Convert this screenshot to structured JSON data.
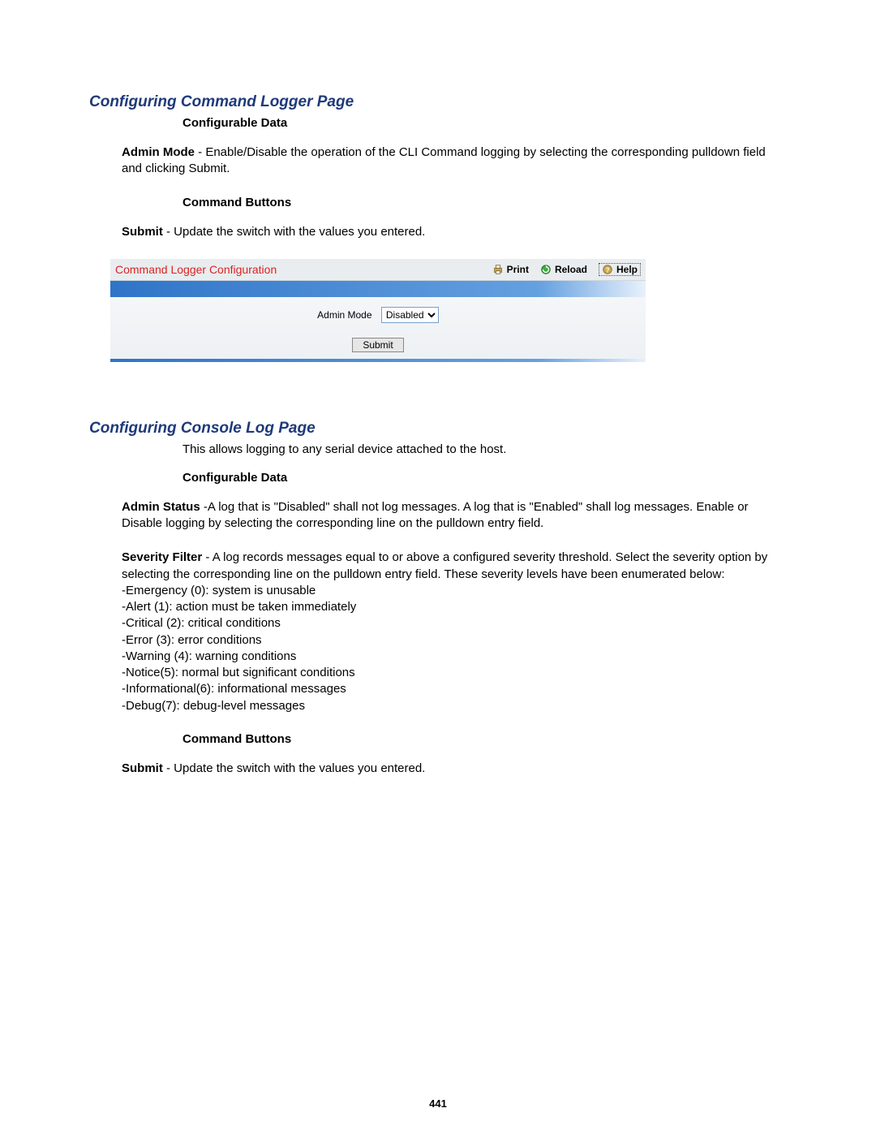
{
  "page_number": "441",
  "section1": {
    "heading": "Configuring Command Logger Page",
    "configurable_data_label": "Configurable Data",
    "admin_mode": {
      "term": "Admin Mode",
      "desc": " - Enable/Disable the operation of the CLI Command logging by selecting the corresponding pulldown field and clicking Submit."
    },
    "command_buttons_label": "Command Buttons",
    "submit_desc": {
      "term": "Submit",
      "desc": " - Update the switch with the values you entered."
    }
  },
  "ui_panel": {
    "title": "Command Logger Configuration",
    "actions": {
      "print": "Print",
      "reload": "Reload",
      "help": "Help"
    },
    "admin_mode_label": "Admin Mode",
    "admin_mode_value": "Disabled",
    "submit_label": "Submit"
  },
  "section2": {
    "heading": "Configuring Console Log Page",
    "intro": "This allows logging to any serial device attached to the host.",
    "configurable_data_label": "Configurable Data",
    "admin_status": {
      "term": "Admin Status",
      "desc": " -A log that is \"Disabled\" shall not log messages. A log that is \"Enabled\" shall log messages. Enable or Disable logging by selecting the corresponding line on the pulldown entry field."
    },
    "severity": {
      "term": "Severity Filter",
      "desc": " - A log records messages equal to or above a configured severity threshold. Select the severity option by selecting the corresponding line on the pulldown entry field. These severity levels have been enumerated below:",
      "levels": [
        "-Emergency (0): system is unusable",
        "-Alert (1): action must be taken immediately",
        "-Critical (2): critical conditions",
        "-Error (3): error conditions",
        "-Warning (4): warning conditions",
        "-Notice(5): normal but significant conditions",
        "-Informational(6): informational messages",
        "-Debug(7): debug-level messages"
      ]
    },
    "command_buttons_label": "Command Buttons",
    "submit_desc": {
      "term": "Submit",
      "desc": " - Update the switch with the values you entered."
    }
  }
}
